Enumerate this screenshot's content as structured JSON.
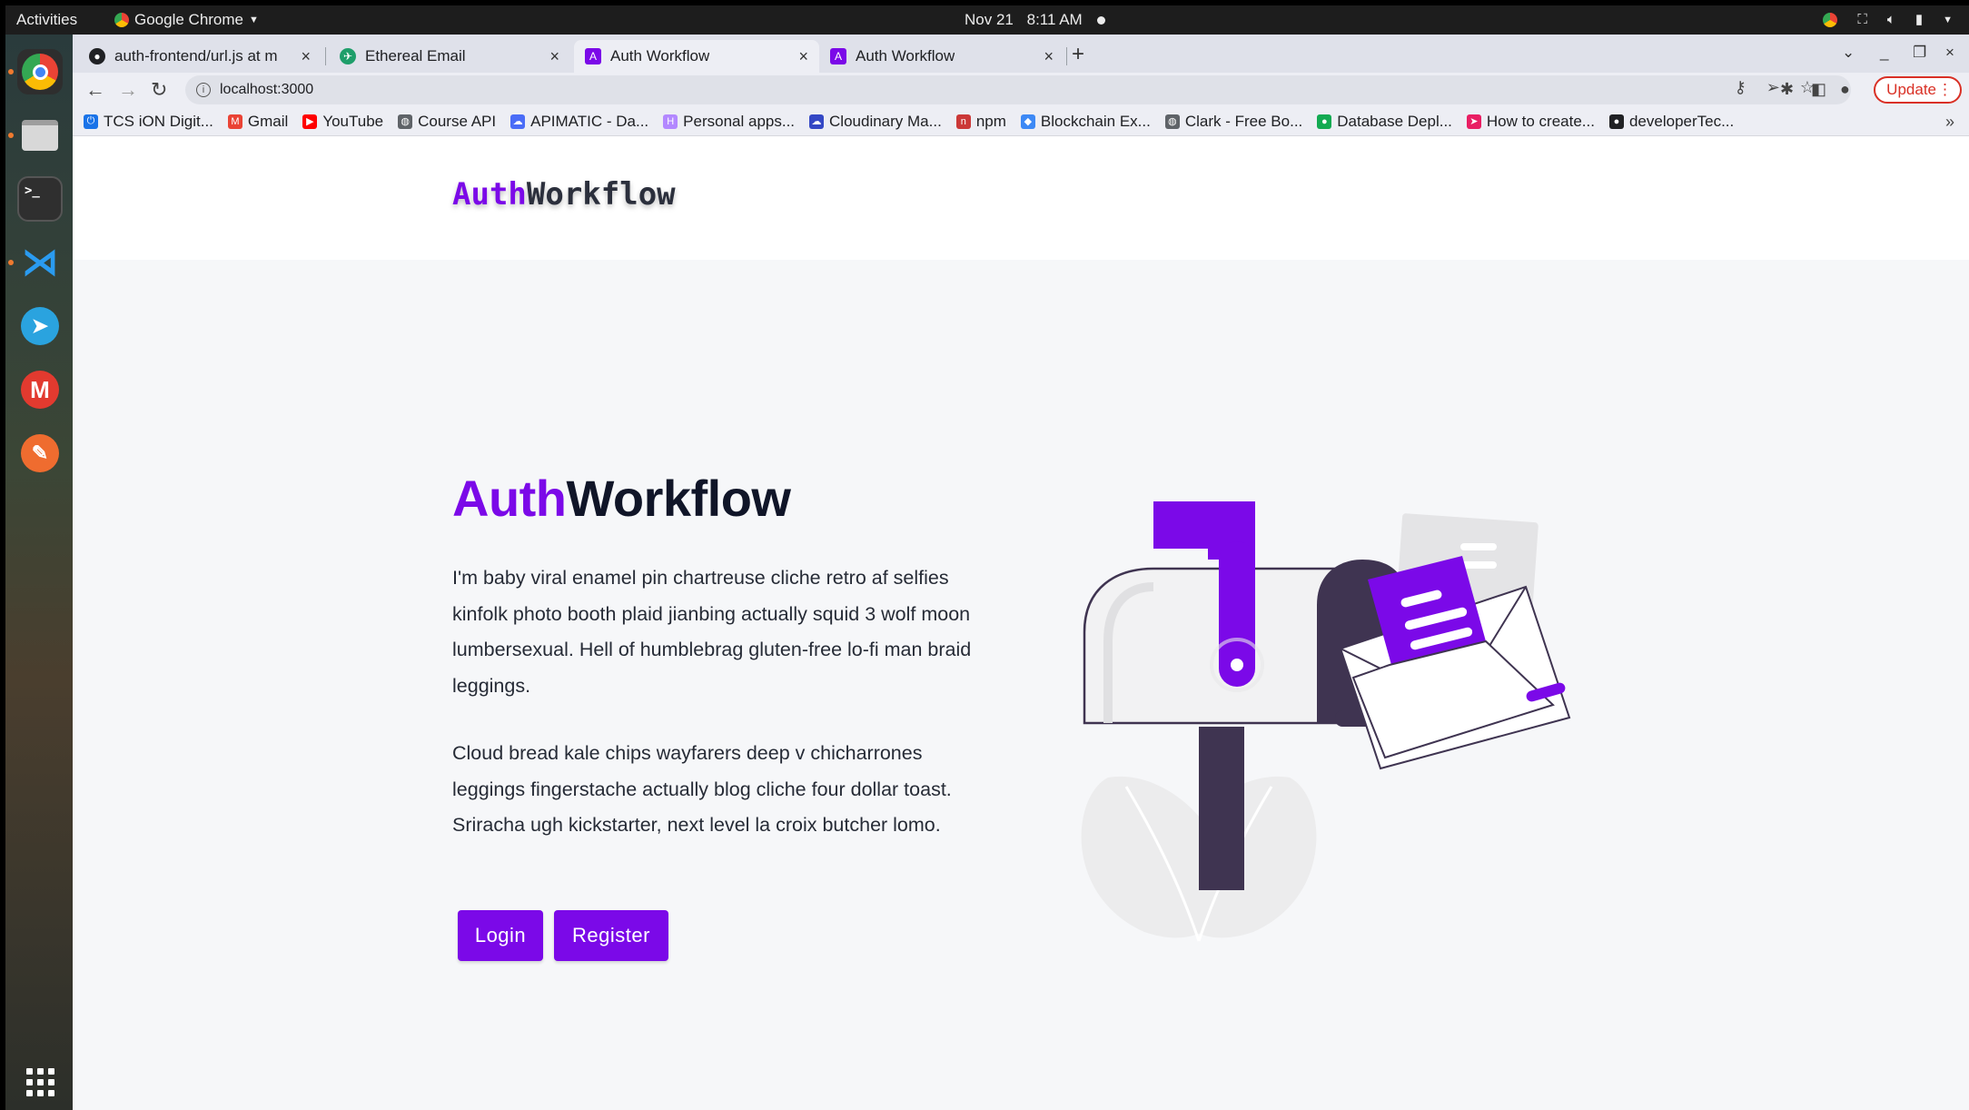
{
  "system": {
    "activities": "Activities",
    "app_name": "Google Chrome",
    "date": "Nov 21",
    "time": "8:11 AM"
  },
  "tabs": [
    {
      "label": "auth-frontend/url.js at m",
      "icon": "github-icon"
    },
    {
      "label": "Ethereal Email",
      "icon": "ethereal-icon"
    },
    {
      "label": "Auth Workflow",
      "icon": "auth-workflow-icon",
      "active": true
    },
    {
      "label": "Auth Workflow",
      "icon": "auth-workflow-icon"
    }
  ],
  "address_bar": {
    "url": "localhost:3000",
    "update_label": "Update"
  },
  "bookmarks": [
    {
      "label": "TCS iON Digit...",
      "color": "#1a73e8",
      "glyph": "⏻"
    },
    {
      "label": "Gmail",
      "color": "#ea4335",
      "glyph": "M"
    },
    {
      "label": "YouTube",
      "color": "#ff0000",
      "glyph": "▶"
    },
    {
      "label": "Course API",
      "color": "#5f6368",
      "glyph": "◍"
    },
    {
      "label": "APIMATIC - Da...",
      "color": "#4a6cf7",
      "glyph": "☁"
    },
    {
      "label": "Personal apps...",
      "color": "#b388ff",
      "glyph": "H"
    },
    {
      "label": "Cloudinary Ma...",
      "color": "#3448c5",
      "glyph": "☁"
    },
    {
      "label": "npm",
      "color": "#cb3837",
      "glyph": "n"
    },
    {
      "label": "Blockchain Ex...",
      "color": "#3d89f5",
      "glyph": "◆"
    },
    {
      "label": "Clark - Free Bo...",
      "color": "#5f6368",
      "glyph": "◍"
    },
    {
      "label": "Database Depl...",
      "color": "#13aa52",
      "glyph": "●"
    },
    {
      "label": "How to create...",
      "color": "#e91e63",
      "glyph": "➤"
    },
    {
      "label": "developerTec...",
      "color": "#202124",
      "glyph": "●"
    }
  ],
  "page": {
    "logo_accent": "Auth",
    "logo_rest": "Workflow",
    "hero_title_accent": "Auth",
    "hero_title_rest": "Workflow",
    "paragraph_1": "I'm baby viral enamel pin chartreuse cliche retro af selfies kinfolk photo booth plaid jianbing actually squid 3 wolf moon lumbersexual. Hell of humblebrag gluten-free lo-fi man braid leggings.",
    "paragraph_2": "Cloud bread kale chips wayfarers deep v chicharrones leggings fingerstache actually blog cliche four dollar toast. Sriracha ugh kickstarter, next level la croix butcher lomo.",
    "login_label": "Login",
    "register_label": "Register"
  },
  "colors": {
    "accent": "#7b09e8",
    "dark": "#101528",
    "mailbox_post": "#3f3451"
  }
}
